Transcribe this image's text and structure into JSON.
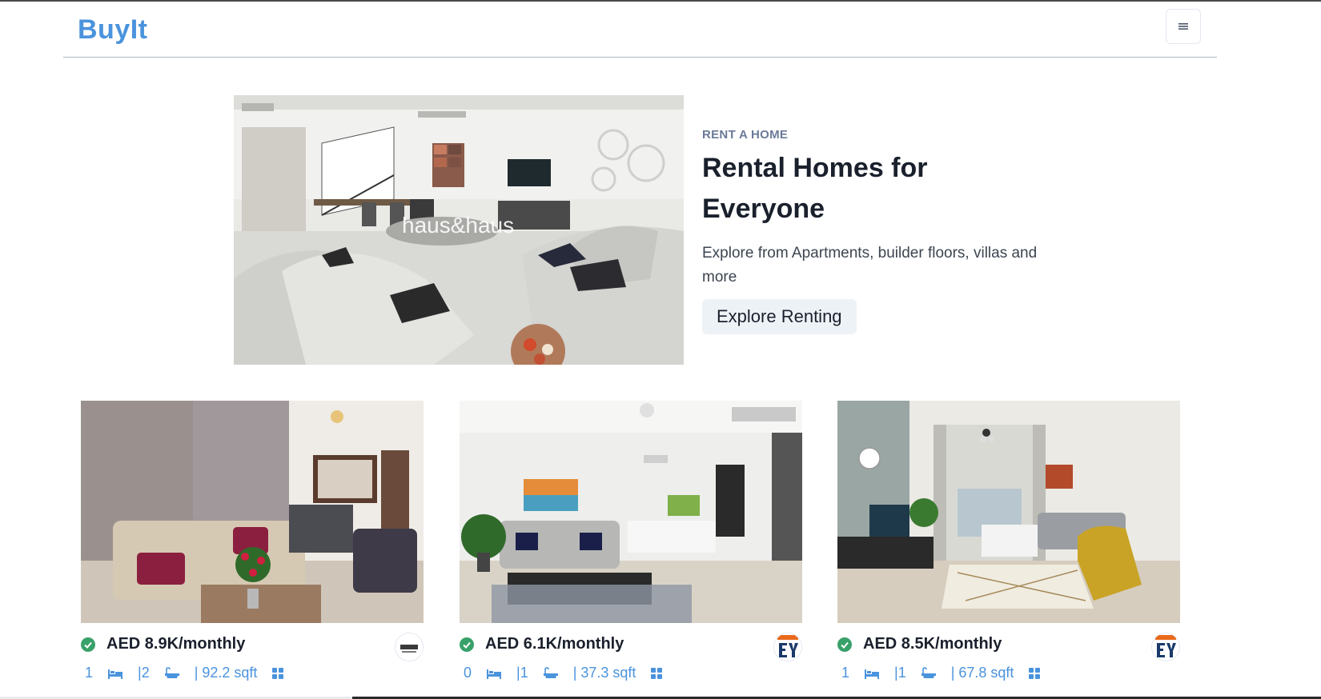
{
  "header": {
    "logo": "BuyIt",
    "menu_icon": "hamburger-menu-icon"
  },
  "hero": {
    "eyebrow": "RENT A HOME",
    "title": "Rental Homes for Everyone",
    "description": "Explore from Apartments, builder floors, villas and more",
    "button_label": "Explore Renting",
    "image_watermark": "haus&haus"
  },
  "listings": [
    {
      "price": "AED 8.9K/monthly",
      "bedrooms": "1",
      "bathrooms": "|2",
      "area": "| 92.2 sqft",
      "verified_icon": "verified-check-icon"
    },
    {
      "price": "AED 6.1K/monthly",
      "bedrooms": "0",
      "bathrooms": "|1",
      "area": "| 37.3 sqft",
      "verified_icon": "verified-check-icon"
    },
    {
      "price": "AED 8.5K/monthly",
      "bedrooms": "1",
      "bathrooms": "|1",
      "area": "| 67.8 sqft",
      "verified_icon": "verified-check-icon"
    }
  ],
  "colors": {
    "brand": "#4a93dd",
    "verified": "#38a169",
    "button_bg": "#edf2f7"
  }
}
